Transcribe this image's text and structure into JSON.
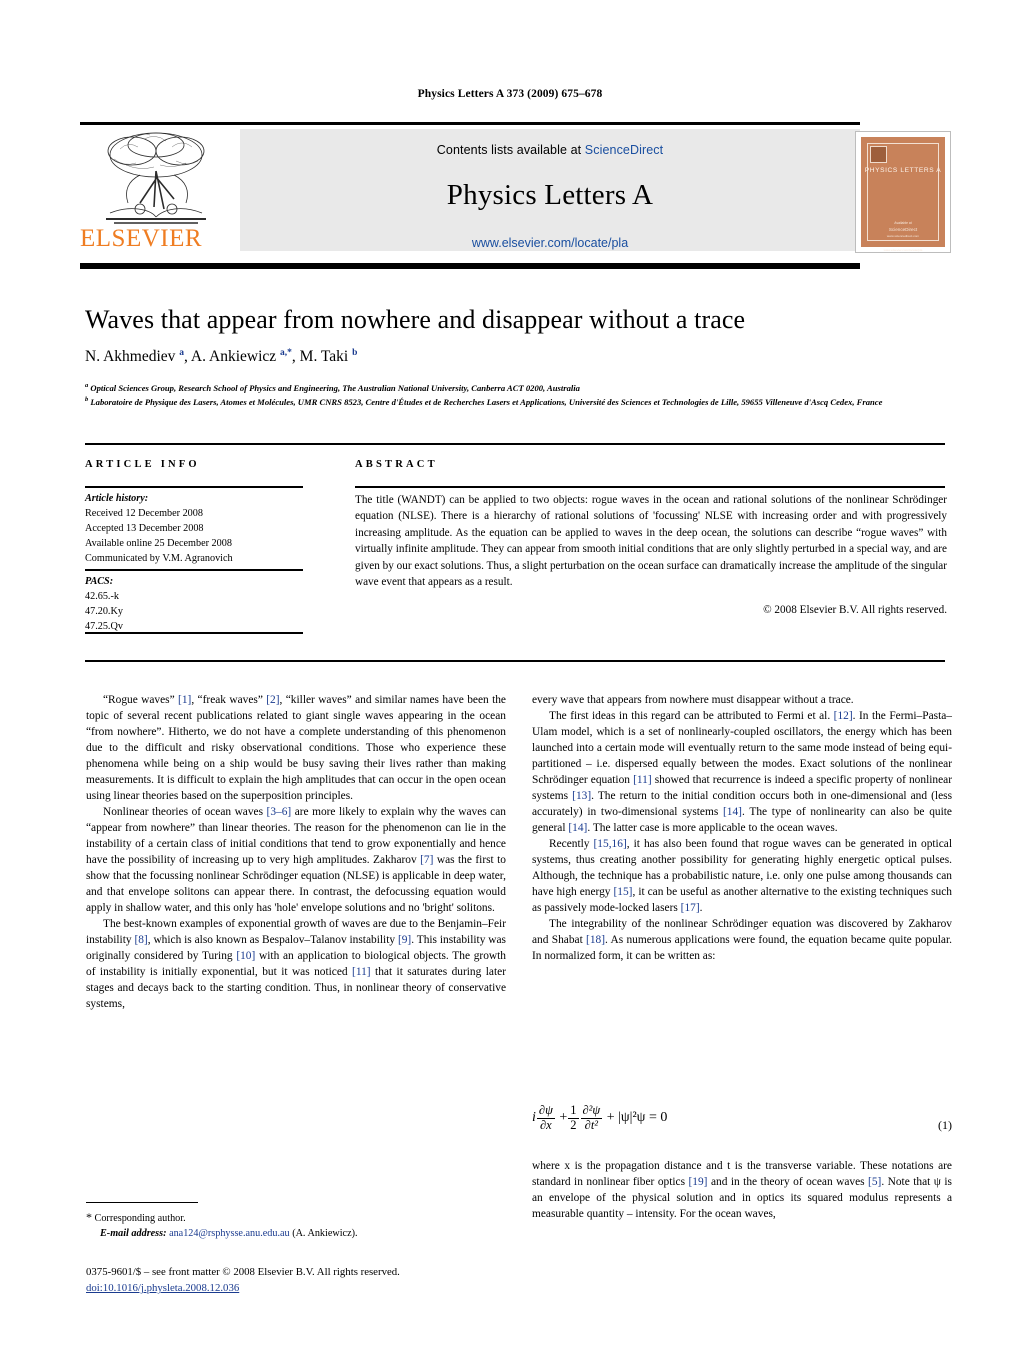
{
  "running_head": "Physics Letters A 373 (2009) 675–678",
  "banner": {
    "contents_prefix": "Contents lists available at ",
    "sciencedirect": "ScienceDirect",
    "journal_name": "Physics Letters A",
    "journal_url": "www.elsevier.com/locate/pla",
    "publisher_logo_text": "ELSEVIER",
    "cover": {
      "title": "PHYSICS LETTERS A",
      "line1": "Available at",
      "line2": "ScienceDirect",
      "line3": "www.sciencedirect.com",
      "line4": "www.elsevier.com/locate/pla"
    }
  },
  "article": {
    "title": "Waves that appear from nowhere and disappear without a trace",
    "authors_html": "N. Akhmediev <sup>a</sup>, A. Ankiewicz <sup>a,</sup><sup class=\"star\">*</sup>, M. Taki <sup>b</sup>",
    "affiliation_a": "Optical Sciences Group, Research School of Physics and Engineering, The Australian National University, Canberra ACT 0200, Australia",
    "affiliation_b": "Laboratoire de Physique des Lasers, Atomes et Molécules, UMR CNRS 8523, Centre d'Études et de Recherches Lasers et Applications, Université des Sciences et Technologies de Lille, 59655 Villeneuve d'Ascq Cedex, France"
  },
  "info": {
    "heading": "ARTICLE INFO",
    "history_label": "Article history:",
    "history": [
      "Received 12 December 2008",
      "Accepted 13 December 2008",
      "Available online 25 December 2008",
      "Communicated by V.M. Agranovich"
    ],
    "pacs_label": "PACS:",
    "pacs": [
      "42.65.-k",
      "47.20.Ky",
      "47.25.Qv"
    ]
  },
  "abstract": {
    "heading": "ABSTRACT",
    "text": "The title (WANDT) can be applied to two objects: rogue waves in the ocean and rational solutions of the nonlinear Schrödinger equation (NLSE). There is a hierarchy of rational solutions of 'focussing' NLSE with increasing order and with progressively increasing amplitude. As the equation can be applied to waves in the deep ocean, the solutions can describe “rogue waves” with virtually infinite amplitude. They can appear from smooth initial conditions that are only slightly perturbed in a special way, and are given by our exact solutions. Thus, a slight perturbation on the ocean surface can dramatically increase the amplitude of the singular wave event that appears as a result.",
    "copyright": "© 2008 Elsevier B.V. All rights reserved."
  },
  "body": {
    "left_paragraphs": [
      "“Rogue waves” [1], “freak waves” [2], “killer waves” and similar names have been the topic of several recent publications related to giant single waves appearing in the ocean “from nowhere”. Hitherto, we do not have a complete understanding of this phenomenon due to the difficult and risky observational conditions. Those who experience these phenomena while being on a ship would be busy saving their lives rather than making measurements. It is difficult to explain the high amplitudes that can occur in the open ocean using linear theories based on the superposition principles.",
      "Nonlinear theories of ocean waves [3–6] are more likely to explain why the waves can “appear from nowhere” than linear theories. The reason for the phenomenon can lie in the instability of a certain class of initial conditions that tend to grow exponentially and hence have the possibility of increasing up to very high amplitudes. Zakharov [7] was the first to show that the focussing nonlinear Schrödinger equation (NLSE) is applicable in deep water, and that envelope solitons can appear there. In contrast, the defocussing equation would apply in shallow water, and this only has 'hole' envelope solutions and no 'bright' solitons.",
      "The best-known examples of exponential growth of waves are due to the Benjamin–Feir instability [8], which is also known as Bespalov–Talanov instability [9]. This instability was originally considered by Turing [10] with an application to biological objects. The growth of instability is initially exponential, but it was noticed [11] that it saturates during later stages and decays back to the starting condition. Thus, in nonlinear theory of conservative systems,"
    ],
    "right_paragraphs": [
      "every wave that appears from nowhere must disappear without a trace.",
      "The first ideas in this regard can be attributed to Fermi et al. [12]. In the Fermi–Pasta–Ulam model, which is a set of nonlinearly-coupled oscillators, the energy which has been launched into a certain mode will eventually return to the same mode instead of being equi-partitioned – i.e. dispersed equally between the modes. Exact solutions of the nonlinear Schrödinger equation [11] showed that recurrence is indeed a specific property of nonlinear systems [13]. The return to the initial condition occurs both in one-dimensional and (less accurately) in two-dimensional systems [14]. The type of nonlinearity can also be quite general [14]. The latter case is more applicable to the ocean waves.",
      "Recently [15,16], it has also been found that rogue waves can be generated in optical systems, thus creating another possibility for generating highly energetic optical pulses. Although, the technique has a probabilistic nature, i.e. only one pulse among thousands can have high energy [15], it can be useful as another alternative to the existing techniques such as passively mode-locked lasers [17].",
      "The integrability of the nonlinear Schrödinger equation was discovered by Zakharov and Shabat [18]. As numerous applications were found, the equation became quite popular. In normalized form, it can be written as:"
    ],
    "after_equation": "where x is the propagation distance and t is the transverse variable. These notations are standard in nonlinear fiber optics [19] and in the theory of ocean waves [5]. Note that ψ is an envelope of the physical solution and in optics its squared modulus represents a measurable quantity – intensity. For the ocean waves,"
  },
  "equation": {
    "number": "(1)",
    "plain": "i ∂ψ/∂x + 1/2 ∂²ψ/∂t² + |ψ|²ψ = 0",
    "parts": {
      "i": "i",
      "num1": "∂ψ",
      "den1": "∂x",
      "plus1": "+",
      "num2": "1",
      "den2": "2",
      "num3": "∂²ψ",
      "den3": "∂t²",
      "plus2": "+",
      "tail": "|ψ|²ψ = 0"
    }
  },
  "footnote": {
    "star": "*",
    "corresponding": "Corresponding author.",
    "email_label": "E-mail address:",
    "email": "ana124@rsphysse.anu.edu.au",
    "email_owner": "(A. Ankiewicz)."
  },
  "footer": {
    "issn_line": "0375-9601/$ – see front matter © 2008 Elsevier B.V. All rights reserved.",
    "doi": "doi:10.1016/j.physleta.2008.12.036"
  },
  "colors": {
    "link_blue": "#1a4fa0",
    "ref_blue": "#1a3b8f",
    "elsevier_orange": "#ef7d22",
    "banner_grey": "#e9e9e9",
    "cover_orange": "#c8825a"
  }
}
